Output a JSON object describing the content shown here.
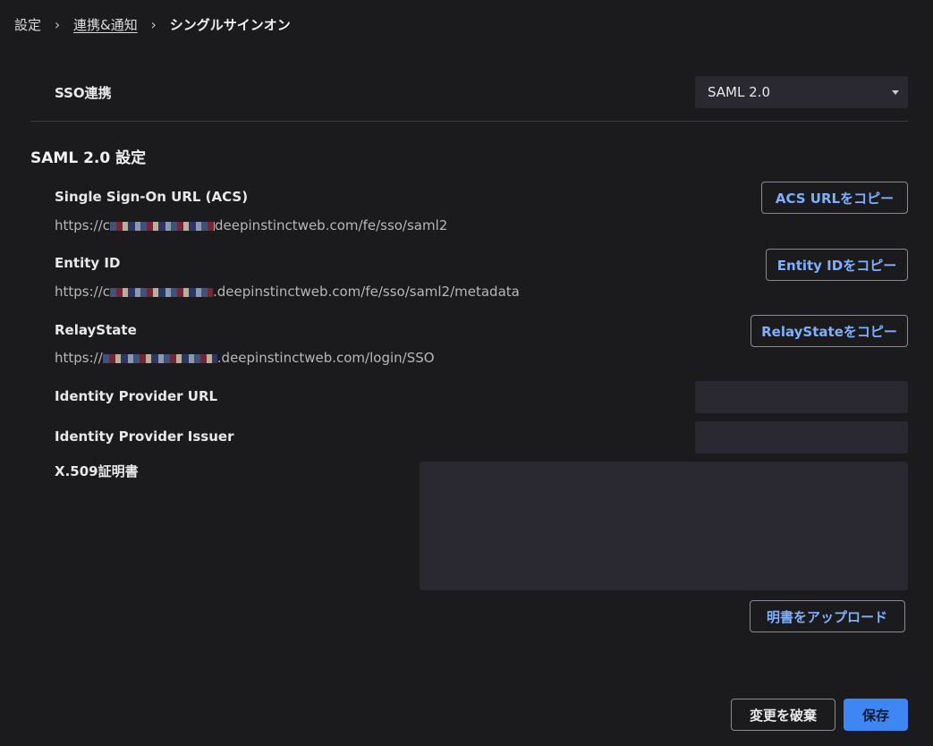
{
  "breadcrumb": {
    "items": [
      "設定",
      "連携&通知",
      "シングルサインオン"
    ]
  },
  "sso": {
    "label": "SSO連携",
    "selected": "SAML 2.0"
  },
  "section_title": "SAML 2.0 設定",
  "fields": {
    "acs": {
      "label": "Single Sign-On URL (ACS)",
      "value_prefix": "https://c",
      "value_suffix": "deepinstinctweb.com/fe/sso/saml2",
      "button": "ACS URLをコピー"
    },
    "entity": {
      "label": "Entity ID",
      "value_prefix": "https://c",
      "value_suffix": ".deepinstinctweb.com/fe/sso/saml2/metadata",
      "button": "Entity IDをコピー"
    },
    "relay": {
      "label": "RelayState",
      "value_prefix": "https://",
      "value_suffix": ".deepinstinctweb.com/login/SSO",
      "button": "RelayStateをコピー"
    },
    "idp_url": {
      "label": "Identity Provider URL",
      "value": ""
    },
    "idp_issuer": {
      "label": "Identity Provider Issuer",
      "value": ""
    },
    "cert": {
      "label": "X.509証明書",
      "value": "",
      "upload_button": "明書をアップロード"
    }
  },
  "footer": {
    "discard": "変更を破棄",
    "save": "保存"
  },
  "colors": {
    "background": "#1b1b1e",
    "input": "#2a2830",
    "accent": "#3f86f5",
    "link": "#7fb0ff"
  }
}
